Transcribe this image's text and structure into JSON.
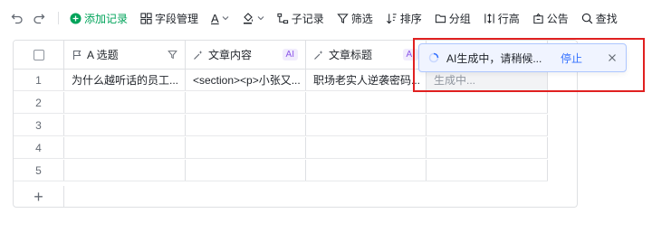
{
  "toolbar": {
    "add_record": "添加记录",
    "field_manage": "字段管理",
    "text_style": "A",
    "sub_record": "子记录",
    "filter": "筛选",
    "sort": "排序",
    "group": "分组",
    "row_height": "行高",
    "notice": "公告",
    "search": "查找"
  },
  "table": {
    "columns": [
      {
        "label": "A 选题",
        "icon": "flag-icon"
      },
      {
        "label": "文章内容",
        "icon": "ai-wand-icon",
        "tag": "AI"
      },
      {
        "label": "文章标题",
        "icon": "ai-wand-icon",
        "tag": "AI"
      }
    ],
    "rows": [
      {
        "num": "1",
        "topic": "为什么越听话的员工...",
        "content": "<section><p>小张又...",
        "title": "职场老实人逆袭密码...",
        "gen": "生成中..."
      },
      {
        "num": "2",
        "topic": "",
        "content": "",
        "title": "",
        "gen": ""
      },
      {
        "num": "3",
        "topic": "",
        "content": "",
        "title": "",
        "gen": ""
      },
      {
        "num": "4",
        "topic": "",
        "content": "",
        "title": "",
        "gen": ""
      },
      {
        "num": "5",
        "topic": "",
        "content": "",
        "title": "",
        "gen": ""
      }
    ],
    "add_row": "+"
  },
  "toast": {
    "text": "AI生成中，请稍候...",
    "stop": "停止"
  },
  "colors": {
    "accent": "#3370ff",
    "green": "#00a35a",
    "ai_purple": "#8c56e8",
    "highlight_red": "#e02020"
  }
}
